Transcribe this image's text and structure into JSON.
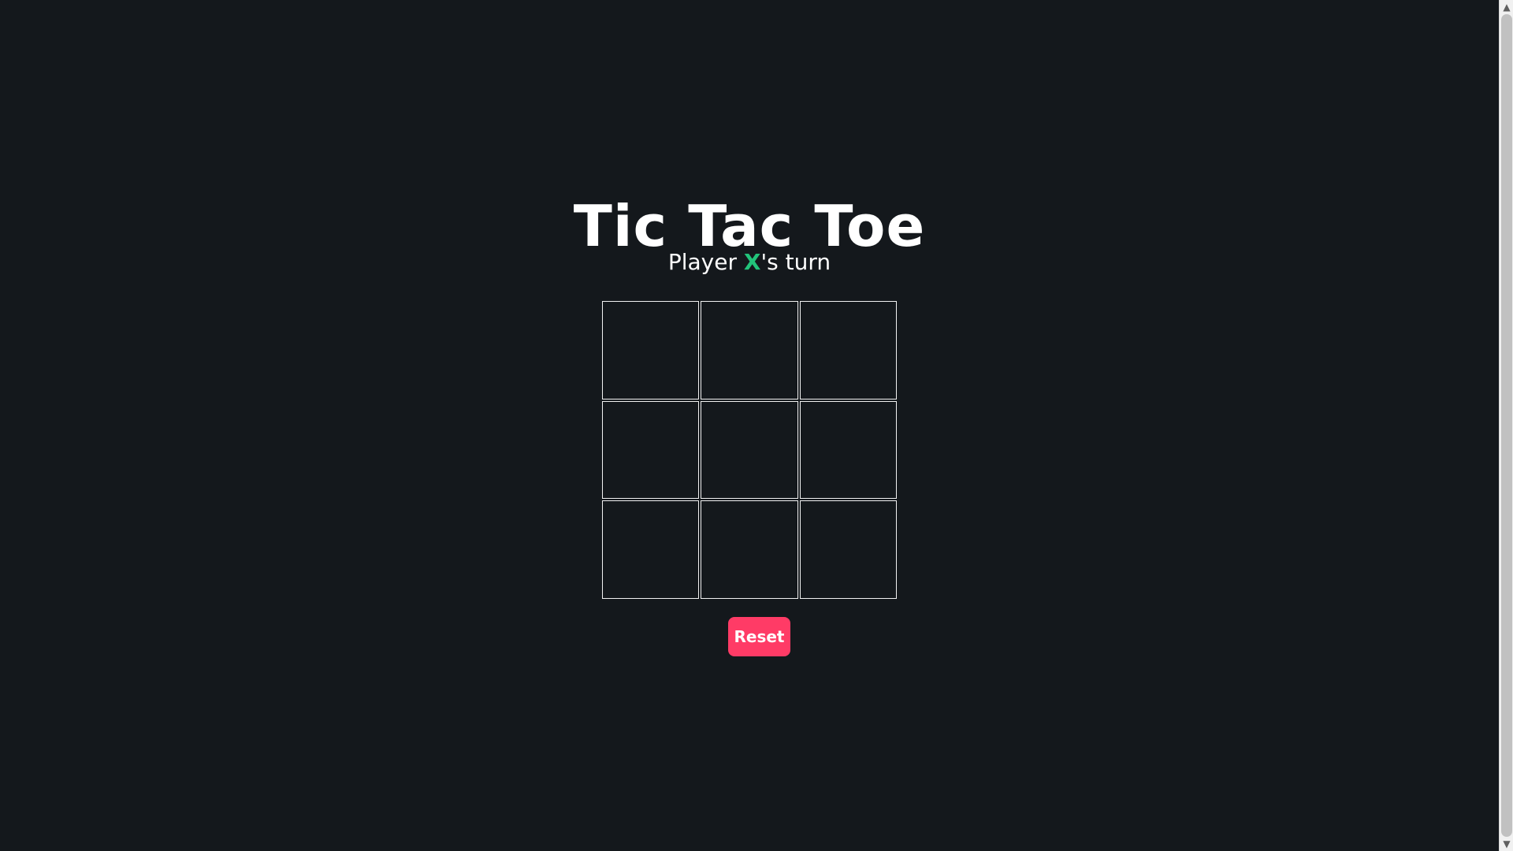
{
  "game": {
    "title": "Tic Tac Toe",
    "status": {
      "prefix": "Player ",
      "player": "X",
      "suffix": "'s turn"
    },
    "board": [
      "",
      "",
      "",
      "",
      "",
      "",
      "",
      "",
      ""
    ],
    "reset_label": "Reset"
  },
  "colors": {
    "background": "#14181c",
    "text": "#ffffff",
    "player_x": "#22c37a",
    "reset_button": "#ff3b66"
  },
  "icons": {
    "scroll_up": "chevron-up-icon",
    "scroll_down": "chevron-down-icon"
  }
}
